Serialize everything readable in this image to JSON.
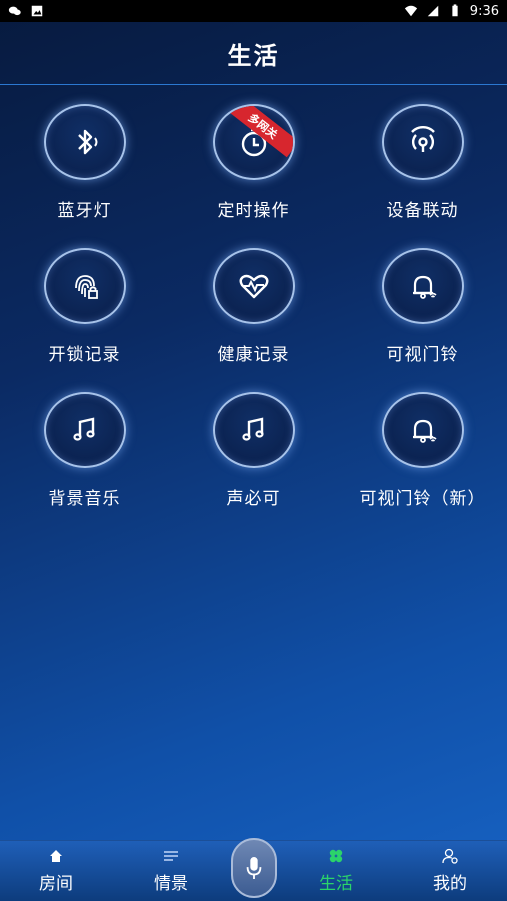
{
  "status": {
    "time": "9:36"
  },
  "header": {
    "title": "生活"
  },
  "tiles": [
    {
      "label": "蓝牙灯",
      "icon": "bluetooth-icon"
    },
    {
      "label": "定时操作",
      "icon": "timer-icon",
      "badge": "多网关"
    },
    {
      "label": "设备联动",
      "icon": "linkage-icon"
    },
    {
      "label": "开锁记录",
      "icon": "fingerprint-lock-icon"
    },
    {
      "label": "健康记录",
      "icon": "heart-pulse-icon"
    },
    {
      "label": "可视门铃",
      "icon": "doorbell-icon"
    },
    {
      "label": "背景音乐",
      "icon": "music-note-icon"
    },
    {
      "label": "声必可",
      "icon": "music-note-icon"
    },
    {
      "label": "可视门铃（新）",
      "icon": "doorbell-icon"
    }
  ],
  "tabs": [
    {
      "label": "房间",
      "icon": "home-icon"
    },
    {
      "label": "情景",
      "icon": "menu-lines-icon"
    },
    {
      "label": "生活",
      "icon": "clover-icon",
      "active": true
    },
    {
      "label": "我的",
      "icon": "user-settings-icon"
    }
  ],
  "colors": {
    "accent_active": "#2bd46a",
    "badge": "#d7262e"
  }
}
